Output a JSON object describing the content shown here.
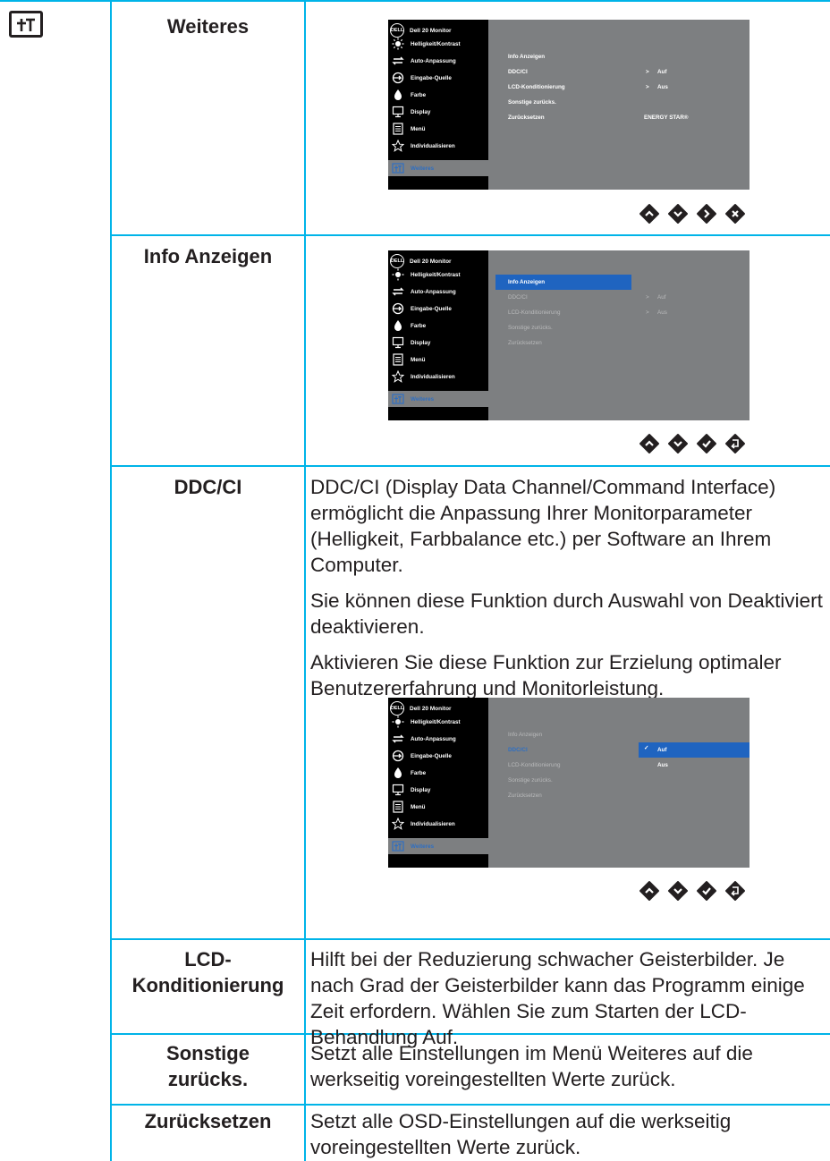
{
  "tab_icon": "others-menu-icon",
  "rows": {
    "weiteres": {
      "label": "Weiteres"
    },
    "info": {
      "label": "Info Anzeigen"
    },
    "ddcci": {
      "label": "DDC/CI",
      "paragraphs": [
        "DDC/CI (Display Data Channel/Command Interface) ermöglicht die Anpassung Ihrer Monitorparameter (Helligkeit, Farbbalance etc.) per Software an Ihrem Computer.",
        "Sie können diese Funktion durch Auswahl von Deaktiviert deaktivieren.",
        "Aktivieren Sie diese Funktion zur Erzielung optimaler Benutzererfahrung und Monitorleistung."
      ]
    },
    "lcd": {
      "label": "LCD-Konditionierung",
      "label_line1": "LCD-",
      "label_line2": "Konditionierung",
      "text": "Hilft bei der Reduzierung schwacher Geisterbilder. Je nach Grad der Geisterbilder kann das Programm einige Zeit erfordern. Wählen Sie zum Starten der LCD-Behandlung Auf."
    },
    "sonstige": {
      "label_line1": "Sonstige",
      "label_line2": "zurücks.",
      "text": "Setzt alle Einstellungen im Menü Weiteres auf die werkseitig voreingestellten Werte zurück."
    },
    "reset": {
      "label": "Zurücksetzen",
      "text": "Setzt alle OSD-Einstellungen auf die werkseitig voreingestellten Werte zurück."
    }
  },
  "osd": {
    "logo": "DELL",
    "title": "Dell 20 Monitor",
    "menu": [
      {
        "label": "Helligkeit/Kontrast",
        "icon": "brightness-icon"
      },
      {
        "label": "Auto-Anpassung",
        "icon": "auto-adjust-icon"
      },
      {
        "label": "Eingabe-Quelle",
        "icon": "input-source-icon"
      },
      {
        "label": "Farbe",
        "icon": "color-icon"
      },
      {
        "label": "Display",
        "icon": "display-icon"
      },
      {
        "label": "Menü",
        "icon": "menu-icon"
      },
      {
        "label": "Individualisieren",
        "icon": "star-icon"
      },
      {
        "label": "Weiteres",
        "icon": "others-icon"
      }
    ],
    "submenu": [
      "Info Anzeigen",
      "DDC/CI",
      "LCD-Konditionierung",
      "Sonstige zurücks.",
      "Zurücksetzen"
    ],
    "ddcci_value": "Auf",
    "lcd_value": "Aus",
    "energy_star": "ENERGY STAR®",
    "options": [
      "Auf",
      "Aus"
    ]
  },
  "buttons": {
    "set1": [
      "up-icon",
      "down-icon",
      "right-icon",
      "close-icon"
    ],
    "set2": [
      "up-icon",
      "down-icon",
      "check-icon",
      "back-icon"
    ]
  },
  "colors": {
    "rule": "#00b4e8",
    "osd_bg": "#7d7f81",
    "highlight": "#1f64c0",
    "text": "#231f20"
  }
}
